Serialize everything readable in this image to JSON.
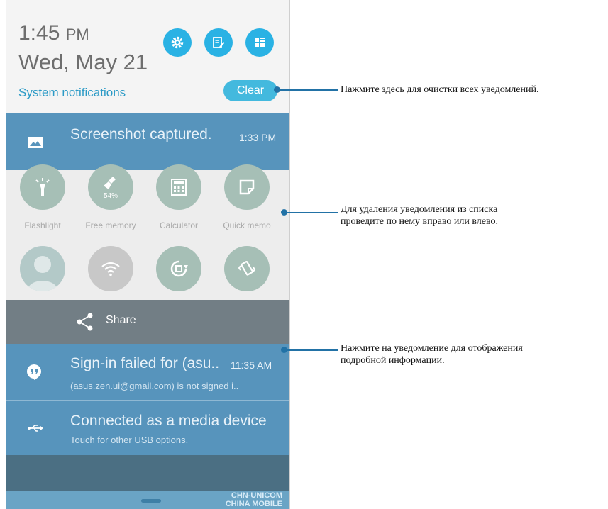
{
  "header": {
    "time": "1:45",
    "ampm": "PM",
    "date": "Wed, May 21",
    "system_notifications": "System notifications",
    "clear_label": "Clear",
    "buttons": [
      "gear-icon",
      "edit-icon",
      "grid-icon"
    ]
  },
  "notifications": [
    {
      "title": "Screenshot captured.",
      "time": "1:33 PM",
      "icon": "image-icon"
    },
    {
      "title": "Sign-in failed for (asu..",
      "time": "11:35 AM",
      "subtitle": "(asus.zen.ui@gmail.com) is not signed i..",
      "icon": "hangouts-icon"
    },
    {
      "title": "Connected as a media device",
      "subtitle": "Touch for other USB options.",
      "icon": "usb-icon"
    }
  ],
  "quick_settings": {
    "row1": [
      {
        "label": "Flashlight",
        "icon": "flashlight-icon"
      },
      {
        "label": "Free memory",
        "icon": "broom-icon",
        "value": "54%"
      },
      {
        "label": "Calculator",
        "icon": "calculator-icon"
      },
      {
        "label": "Quick memo",
        "icon": "memo-icon"
      }
    ],
    "row2": [
      {
        "icon": "avatar-icon"
      },
      {
        "icon": "wifi-icon"
      },
      {
        "icon": "rotation-icon"
      },
      {
        "icon": "vibrate-icon"
      }
    ]
  },
  "share": {
    "label": "Share"
  },
  "carrier": {
    "line1": "CHN-UNICOM",
    "line2": "CHINA MOBILE"
  },
  "callouts": [
    "Нажмите здесь для очистки всех уведомлений.",
    "Для удаления уведомления из списка",
    "проведите по нему вправо или влево.",
    "Нажмите на уведомление для отображения",
    "подробной информации."
  ],
  "colors": {
    "accent": "#2ab2e4",
    "notification_bg": "#5794bc",
    "callout_line": "#2272a6"
  }
}
